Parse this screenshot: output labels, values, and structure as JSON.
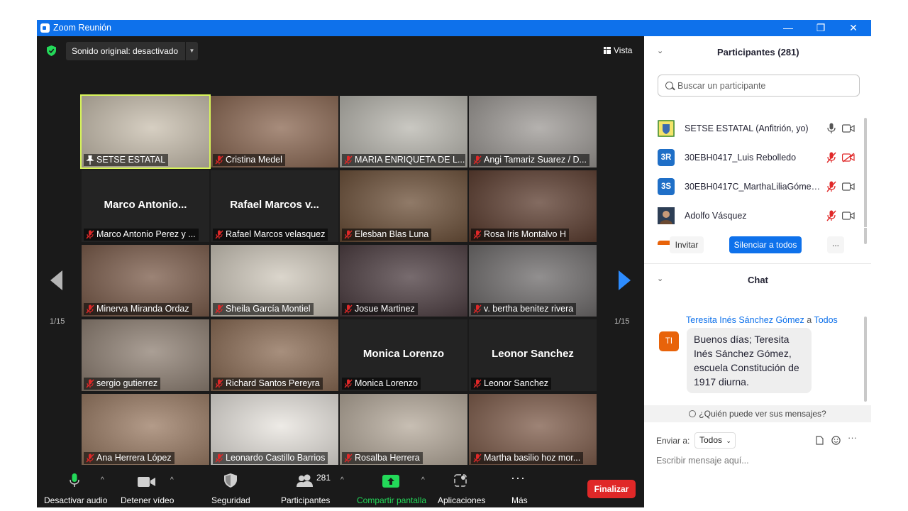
{
  "window": {
    "title": "Zoom Reunión",
    "minimize_glyph": "—",
    "restore_glyph": "❐",
    "close_glyph": "✕"
  },
  "meeting_header": {
    "sound_label": "Sonido original: desactivado",
    "dropdown_glyph": "▼",
    "view_label": "Vista"
  },
  "pager": {
    "left_label": "1/15",
    "right_label": "1/15"
  },
  "tiles": [
    {
      "label": "SETSE ESTATAL",
      "bigname": "",
      "video": true,
      "active": true,
      "bg": "#c9bfae"
    },
    {
      "label": "Cristina Medel",
      "bigname": "",
      "video": true,
      "bg": "#8a6650"
    },
    {
      "label": "MARIA ENRIQUETA DE L...",
      "bigname": "",
      "video": true,
      "bg": "#b8b6ae"
    },
    {
      "label": "Angi Tamariz Suarez / D...",
      "bigname": "",
      "video": true,
      "bg": "#9c9894"
    },
    {
      "label": "Marco Antonio Perez y ...",
      "bigname": "Marco  Antonio...",
      "video": false
    },
    {
      "label": "Rafael Marcos velasquez",
      "bigname": "Rafael  Marcos  v...",
      "video": false
    },
    {
      "label": "Elesban Blas Luna",
      "bigname": "",
      "video": true,
      "bg": "#6b4e36"
    },
    {
      "label": "Rosa Iris Montalvo H",
      "bigname": "",
      "video": true,
      "bg": "#5a3a2c"
    },
    {
      "label": "Minerva Miranda Ordaz",
      "bigname": "",
      "video": true,
      "bg": "#7a5a48"
    },
    {
      "label": "Sheila García Montiel",
      "bigname": "",
      "video": true,
      "bg": "#cfc8bb"
    },
    {
      "label": "Josue Martinez",
      "bigname": "",
      "video": true,
      "bg": "#4a3a3e"
    },
    {
      "label": "v. bertha benitez rivera",
      "bigname": "",
      "video": true,
      "bg": "#6d6a6a"
    },
    {
      "label": "sergio gutierrez",
      "bigname": "",
      "video": true,
      "bg": "#8e7f72"
    },
    {
      "label": "Richard Santos Pereyra",
      "bigname": "",
      "video": true,
      "bg": "#8a6a52"
    },
    {
      "label": "Monica Lorenzo",
      "bigname": "Monica Lorenzo",
      "video": false
    },
    {
      "label": "Leonor Sanchez",
      "bigname": "Leonor Sanchez",
      "video": false
    },
    {
      "label": "Ana Herrera López",
      "bigname": "",
      "video": true,
      "bg": "#9a7a62"
    },
    {
      "label": "Leonardo Castillo Barrios",
      "bigname": "",
      "video": true,
      "bg": "#e8e4de"
    },
    {
      "label": "Rosalba Herrera",
      "bigname": "",
      "video": true,
      "bg": "#b5a99a"
    },
    {
      "label": "Martha basilio hoz mor...",
      "bigname": "",
      "video": true,
      "bg": "#7d5a48"
    }
  ],
  "toolbar": {
    "mute_label": "Desactivar audio",
    "video_label": "Detener vídeo",
    "security_label": "Seguridad",
    "participants_label": "Participantes",
    "participants_count": "281",
    "share_label": "Compartir pantalla",
    "apps_label": "Aplicaciones",
    "more_label": "Más",
    "end_label": "Finalizar",
    "caret": "^"
  },
  "participants_panel": {
    "title": "Participantes (281)",
    "collapse_glyph": "⌄",
    "search_placeholder": "Buscar un participante",
    "rows": [
      {
        "initials": "",
        "name": "SETSE ESTATAL (Anfitrión, yo)",
        "avatar_color": "#f4e46a",
        "mic_muted": false,
        "cam_off": false
      },
      {
        "initials": "3R",
        "name": "30EBH0417_Luis Rebolledo",
        "avatar_color": "#1f6fc7",
        "mic_muted": true,
        "cam_off": true
      },
      {
        "initials": "3S",
        "name": "30EBH0417C_MarthaLiliaGómez...",
        "avatar_color": "#1f6fc7",
        "mic_muted": true,
        "cam_off": false
      },
      {
        "initials": "",
        "name": "Adolfo Vásquez",
        "avatar_color": "#5a4a3a",
        "mic_muted": true,
        "cam_off": false
      }
    ],
    "invite_label": "Invitar",
    "mute_all_label": "Silenciar a todos",
    "more_label": "..."
  },
  "chat_panel": {
    "title": "Chat",
    "sender": "Teresita Inés Sánchez Gómez",
    "to_word": "a",
    "recipient": "Todos",
    "avatar_initials": "TI",
    "message": "Buenos días; Teresita Inés Sánchez Gómez, escuela Constitución de 1917 diurna.",
    "who_sees": "¿Quién puede ver sus mensajes?",
    "send_to_label": "Enviar a:",
    "send_to_value": "Todos",
    "input_placeholder": "Escribir mensaje aquí...",
    "more_glyph": "···"
  },
  "colors": {
    "zoom_blue": "#0e71eb",
    "mute_red": "#e02828",
    "share_green": "#23d959",
    "active_speaker": "#d8f55a"
  }
}
